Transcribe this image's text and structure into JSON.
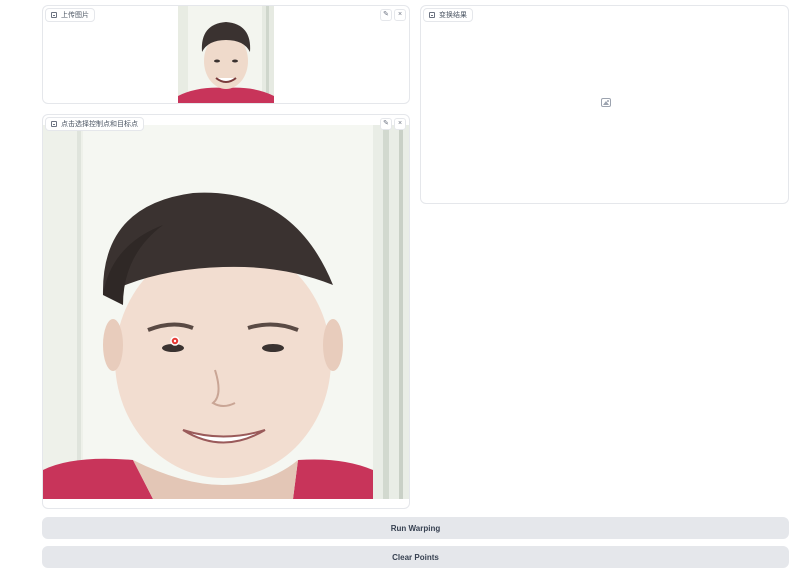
{
  "upload_panel": {
    "label": "上传图片",
    "edit_icon": "pencil-icon",
    "clear_icon": "close-icon"
  },
  "points_panel": {
    "label": "点击选择控制点和目标点",
    "edit_icon": "pencil-icon",
    "clear_icon": "close-icon"
  },
  "result_panel": {
    "label": "变换结果",
    "placeholder_icon": "image-icon"
  },
  "buttons": {
    "run": "Run Warping",
    "clear": "Clear Points"
  },
  "colors": {
    "shirt": "#c8345a",
    "hair": "#3a3230",
    "skin": "#f1dccd",
    "background": "#f5f7f2",
    "button_bg": "#e5e7eb",
    "point": "#e53935"
  }
}
